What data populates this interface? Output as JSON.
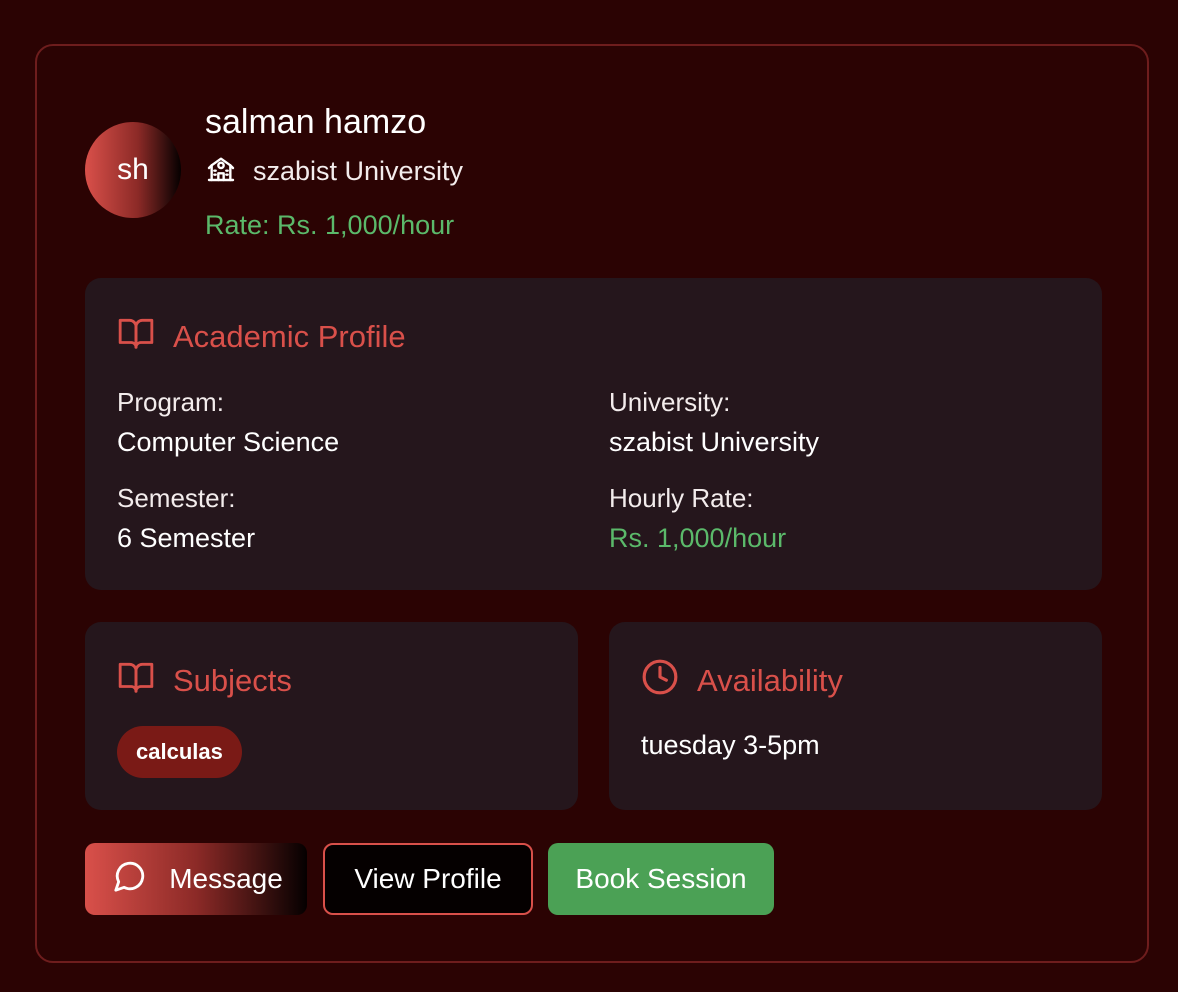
{
  "tutor": {
    "initials": "sh",
    "name": "salman hamzo",
    "university": "szabist University",
    "rate": "Rate: Rs. 1,000/hour"
  },
  "academic_profile": {
    "title": "Academic Profile",
    "program_label": "Program:",
    "program_value": "Computer Science",
    "university_label": "University:",
    "university_value": "szabist University",
    "semester_label": "Semester:",
    "semester_value": "6 Semester",
    "hourly_rate_label": "Hourly Rate:",
    "hourly_rate_value": "Rs. 1,000/hour"
  },
  "subjects": {
    "title": "Subjects",
    "items": [
      "calculas"
    ]
  },
  "availability": {
    "title": "Availability",
    "text": "tuesday 3-5pm"
  },
  "actions": {
    "message": "Message",
    "view_profile": "View Profile",
    "book_session": "Book Session"
  },
  "colors": {
    "background": "#2b0303",
    "accent": "#d9504a",
    "panel": "#25161c",
    "green": "#5bb96a",
    "button_green": "#4ba155"
  }
}
